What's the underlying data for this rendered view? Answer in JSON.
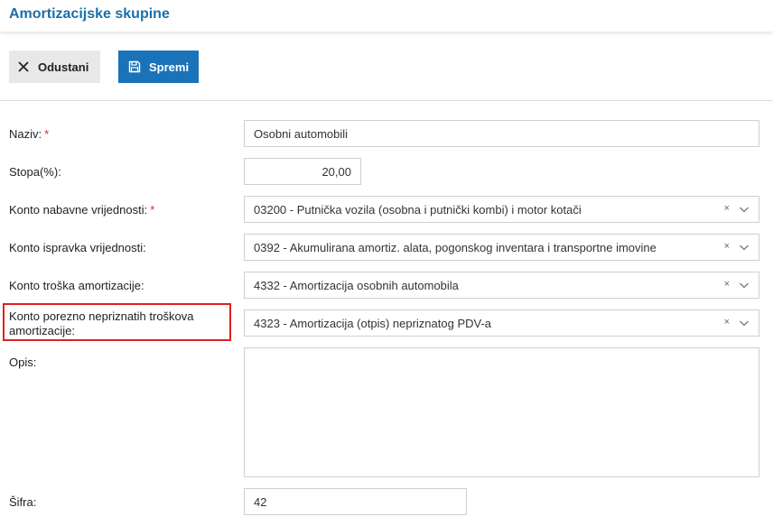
{
  "header": {
    "title": "Amortizacijske skupine"
  },
  "toolbar": {
    "cancel_label": "Odustani",
    "save_label": "Spremi"
  },
  "form": {
    "naziv": {
      "label": "Naziv:",
      "required": "*",
      "value": "Osobni automobili"
    },
    "stopa": {
      "label": "Stopa(%):",
      "value": "20,00"
    },
    "konto_nabavne": {
      "label": "Konto nabavne vrijednosti:",
      "required": "*",
      "value": "03200 - Putnička vozila (osobna i putnički kombi) i motor kotači"
    },
    "konto_ispravka": {
      "label": "Konto ispravka vrijednosti:",
      "value": "0392 - Akumulirana amortiz. alata, pogonskog inventara i transportne imovine"
    },
    "konto_troska": {
      "label": "Konto troška amortizacije:",
      "value": "4332 - Amortizacija osobnih automobila"
    },
    "konto_porezno": {
      "label_line1": "Konto porezno nepriznatih troškova",
      "label_line2": "amortizacije:",
      "value": "4323 - Amortizacija (otpis) nepriznatog PDV-a"
    },
    "opis": {
      "label": "Opis:",
      "value": ""
    },
    "sifra": {
      "label": "Šifra:",
      "value": "42"
    }
  },
  "icons": {
    "clear": "×",
    "colors": {
      "accent": "#1a72b8",
      "title": "#1a6fa8",
      "required": "#d9262a",
      "highlight": "#e02020"
    }
  }
}
